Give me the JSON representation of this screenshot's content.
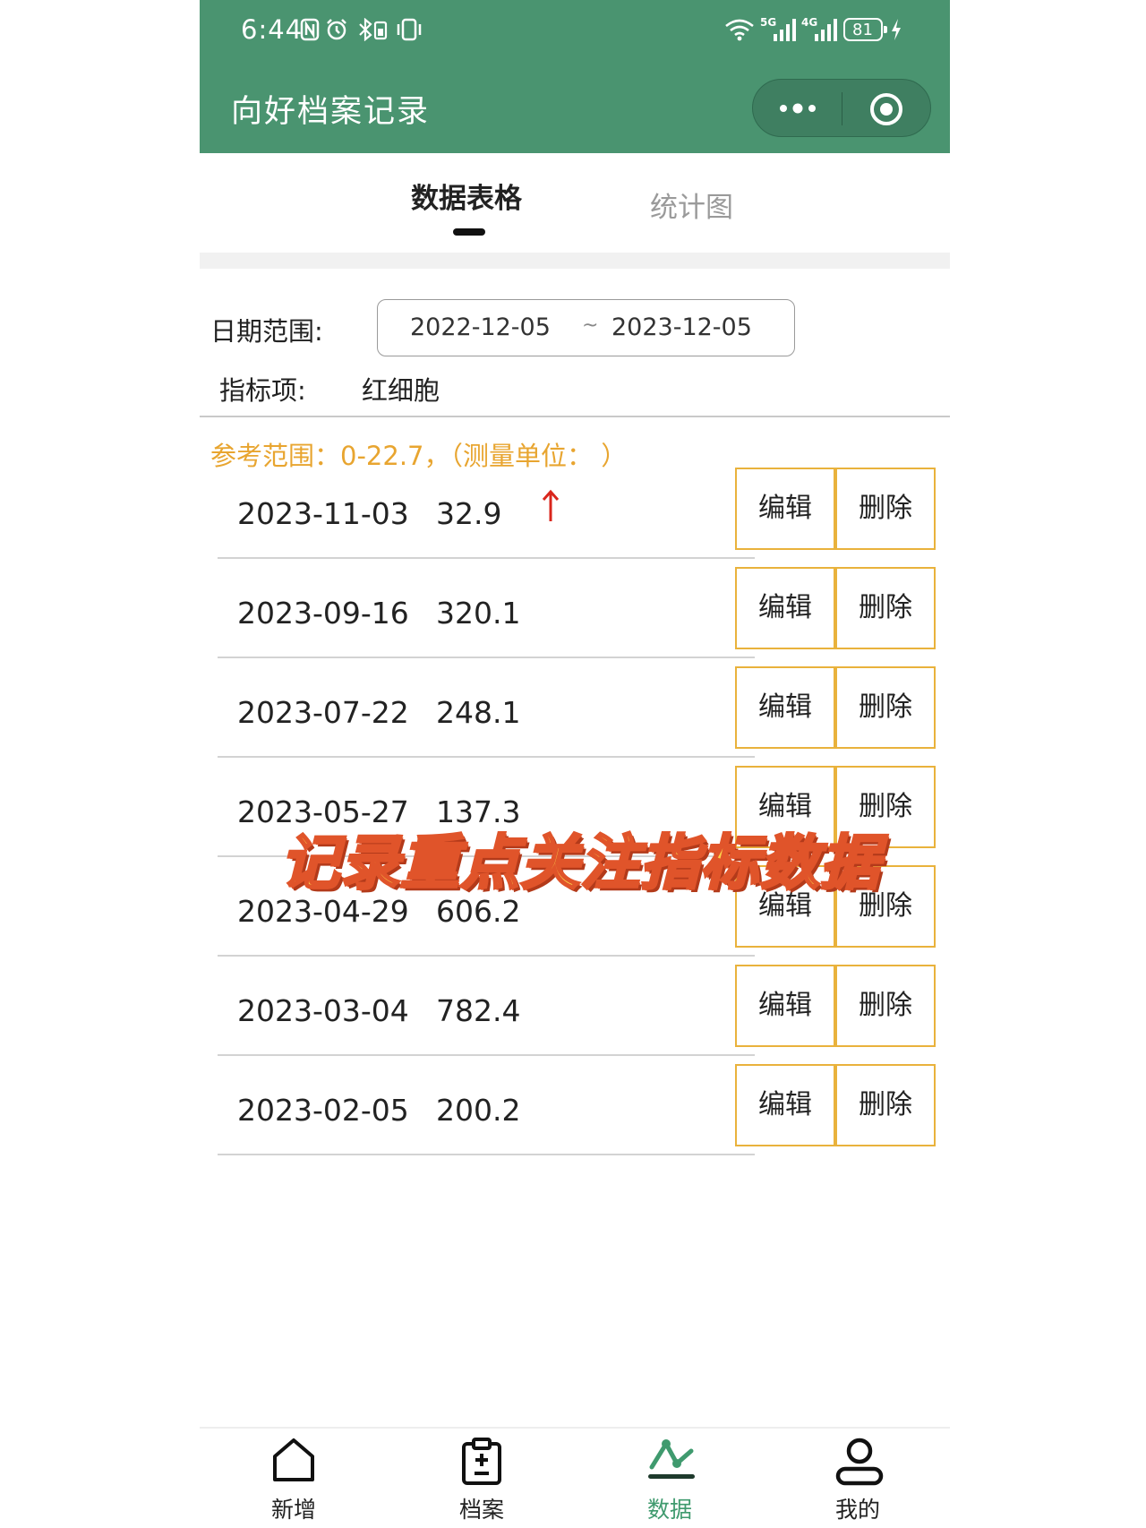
{
  "status_bar": {
    "time": "6:44",
    "network_5g": "5G",
    "network_4g": "4G",
    "battery": "81",
    "icons": [
      "nfc-icon",
      "alarm-icon",
      "bluetooth-icon",
      "vibrate-icon",
      "wifi-icon",
      "signal-5g-icon",
      "signal-4g-icon",
      "battery-icon",
      "charging-icon"
    ]
  },
  "header": {
    "title": "向好档案记录",
    "capsule": {
      "more_icon": "more-dots-icon",
      "close_icon": "target-circle-icon"
    },
    "bg_color": "#4a9470"
  },
  "tabs": [
    {
      "label": "数据表格",
      "active": true
    },
    {
      "label": "统计图",
      "active": false
    }
  ],
  "filters": {
    "date_label": "日期范围:",
    "date_start": "2022-12-05",
    "date_separator": "~",
    "date_end": "2023-12-05",
    "metric_label": "指标项:",
    "metric_value": "红细胞"
  },
  "reference": {
    "text": "参考范围：0-22.7，（测量单位：  ）",
    "color": "#e8a530"
  },
  "records": [
    {
      "date": "2023-11-03",
      "value": "32.9",
      "flag": "↑",
      "edit": "编辑",
      "delete": "删除"
    },
    {
      "date": "2023-09-16",
      "value": "320.1",
      "flag": "",
      "edit": "编辑",
      "delete": "删除"
    },
    {
      "date": "2023-07-22",
      "value": "248.1",
      "flag": "",
      "edit": "编辑",
      "delete": "删除"
    },
    {
      "date": "2023-05-27",
      "value": "137.3",
      "flag": "",
      "edit": "编辑",
      "delete": "删除"
    },
    {
      "date": "2023-04-29",
      "value": "606.2",
      "flag": "",
      "edit": "编辑",
      "delete": "删除"
    },
    {
      "date": "2023-03-04",
      "value": "782.4",
      "flag": "",
      "edit": "编辑",
      "delete": "删除"
    },
    {
      "date": "2023-02-05",
      "value": "200.2",
      "flag": "",
      "edit": "编辑",
      "delete": "删除"
    }
  ],
  "overlay_caption": "记录重点关注指标数据",
  "bottom_nav": [
    {
      "label": "新增",
      "icon": "home-icon",
      "active": false
    },
    {
      "label": "档案",
      "icon": "clipboard-icon",
      "active": false
    },
    {
      "label": "数据",
      "icon": "chart-line-icon",
      "active": true
    },
    {
      "label": "我的",
      "icon": "user-icon",
      "active": false
    }
  ],
  "colors": {
    "accent": "#3f9a6e",
    "button_border": "#e9b23c",
    "alert": "#d9261c"
  }
}
